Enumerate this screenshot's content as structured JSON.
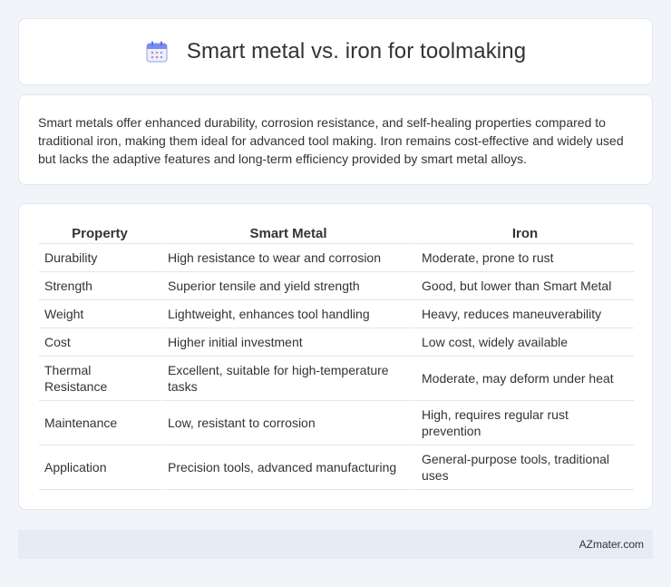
{
  "header": {
    "title": "Smart metal vs. iron for toolmaking",
    "icon": "calendar-icon"
  },
  "summary": {
    "text": "Smart metals offer enhanced durability, corrosion resistance, and self-healing properties compared to traditional iron, making them ideal for advanced tool making. Iron remains cost-effective and widely used but lacks the adaptive features and long-term efficiency provided by smart metal alloys."
  },
  "table": {
    "columns": [
      "Property",
      "Smart Metal",
      "Iron"
    ],
    "rows": [
      [
        "Durability",
        "High resistance to wear and corrosion",
        "Moderate, prone to rust"
      ],
      [
        "Strength",
        "Superior tensile and yield strength",
        "Good, but lower than Smart Metal"
      ],
      [
        "Weight",
        "Lightweight, enhances tool handling",
        "Heavy, reduces maneuverability"
      ],
      [
        "Cost",
        "Higher initial investment",
        "Low cost, widely available"
      ],
      [
        "Thermal Resistance",
        "Excellent, suitable for high-temperature tasks",
        "Moderate, may deform under heat"
      ],
      [
        "Maintenance",
        "Low, resistant to corrosion",
        "High, requires regular rust prevention"
      ],
      [
        "Application",
        "Precision tools, advanced manufacturing",
        "General-purpose tools, traditional uses"
      ]
    ]
  },
  "footer": {
    "text": "AZmater.com"
  },
  "colors": {
    "background": "#f1f4f9",
    "card": "#ffffff",
    "footer_bar": "#e5ecf6",
    "icon_accent": "#7b8cf0"
  }
}
